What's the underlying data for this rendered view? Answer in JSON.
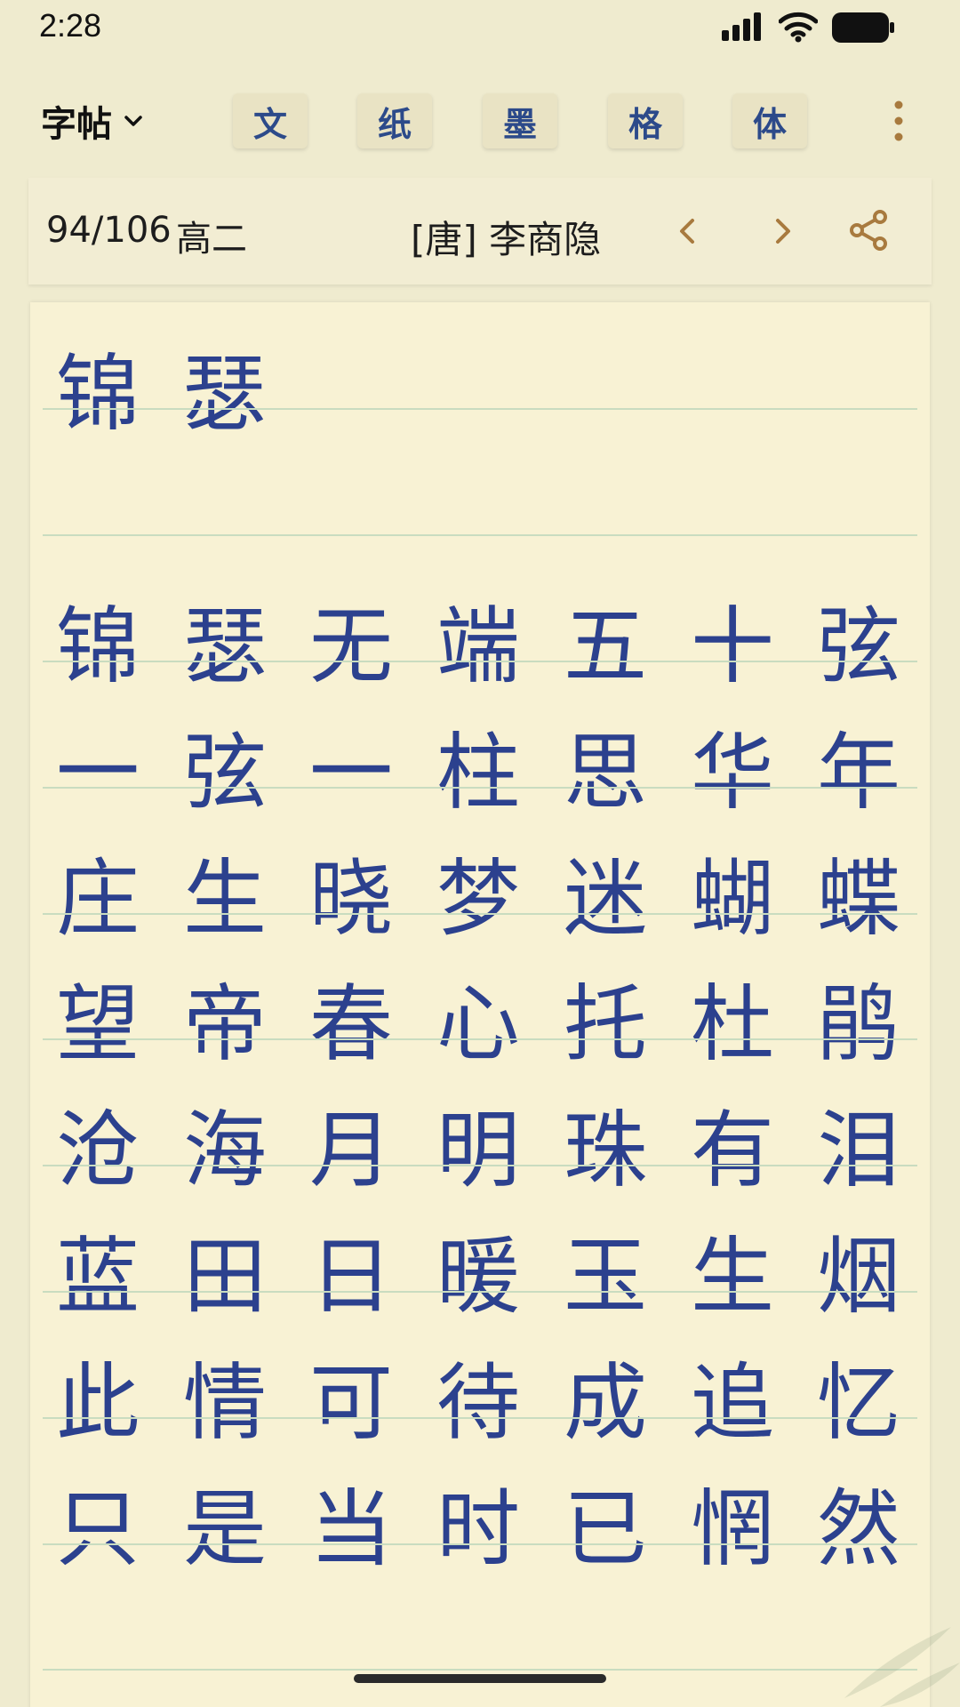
{
  "status_bar": {
    "time": "2:28"
  },
  "toolbar": {
    "title": "字帖",
    "buttons": [
      "文",
      "纸",
      "墨",
      "格",
      "体"
    ]
  },
  "info_bar": {
    "counter": "94/106",
    "grade": "高二",
    "author": "[唐] 李商隐"
  },
  "sheet": {
    "title_chars": [
      "锦",
      "瑟"
    ],
    "rows": [
      [
        "锦",
        "瑟",
        "无",
        "端",
        "五",
        "十",
        "弦"
      ],
      [
        "一",
        "弦",
        "一",
        "柱",
        "思",
        "华",
        "年"
      ],
      [
        "庄",
        "生",
        "晓",
        "梦",
        "迷",
        "蝴",
        "蝶"
      ],
      [
        "望",
        "帝",
        "春",
        "心",
        "托",
        "杜",
        "鹃"
      ],
      [
        "沧",
        "海",
        "月",
        "明",
        "珠",
        "有",
        "泪"
      ],
      [
        "蓝",
        "田",
        "日",
        "暖",
        "玉",
        "生",
        "烟"
      ],
      [
        "此",
        "情",
        "可",
        "待",
        "成",
        "追",
        "忆"
      ],
      [
        "只",
        "是",
        "当",
        "时",
        "已",
        "惘",
        "然"
      ]
    ]
  },
  "colors": {
    "ink": "#2c418e",
    "paper": "#f8f2d4",
    "guide_line": "#c9dcc0",
    "accent": "#a87a3e"
  },
  "icons": [
    "cellular-signal-icon",
    "wifi-icon",
    "battery-icon",
    "chevron-down-icon",
    "more-vertical-icon",
    "chevron-left-icon",
    "chevron-right-icon",
    "share-icon"
  ]
}
